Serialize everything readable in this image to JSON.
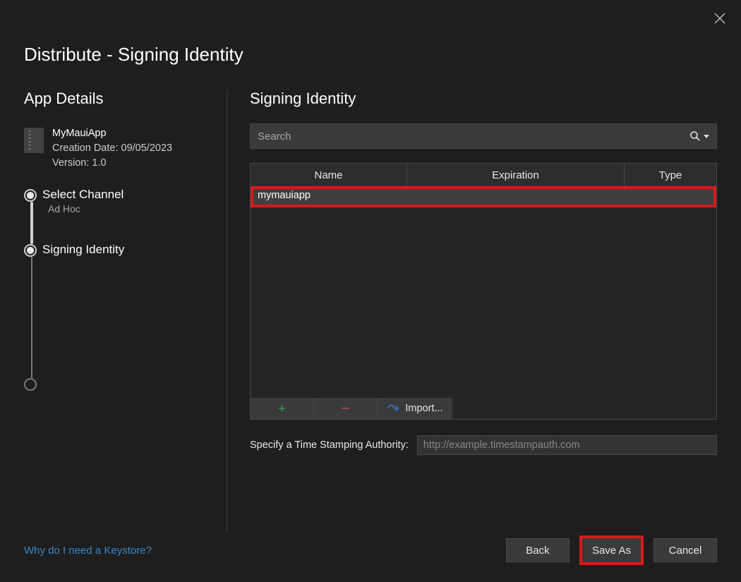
{
  "window": {
    "title": "Distribute - Signing Identity"
  },
  "left": {
    "heading": "App Details",
    "app": {
      "name": "MyMauiApp",
      "creation_line": "Creation Date: 09/05/2023",
      "version_line": "Version: 1.0"
    },
    "steps": [
      {
        "title": "Select Channel",
        "subtitle": "Ad Hoc"
      },
      {
        "title": "Signing Identity",
        "subtitle": ""
      },
      {
        "title": "",
        "subtitle": ""
      }
    ]
  },
  "right": {
    "heading": "Signing Identity",
    "search": {
      "placeholder": "Search",
      "value": ""
    },
    "table": {
      "columns": {
        "name": "Name",
        "expiration": "Expiration",
        "type": "Type"
      },
      "rows": [
        {
          "name": "mymauiapp",
          "expiration": "",
          "type": ""
        }
      ]
    },
    "toolbar": {
      "add": "+",
      "remove": "−",
      "import": "Import..."
    },
    "tsa": {
      "label": "Specify a Time Stamping Authority:",
      "placeholder": "http://example.timestampauth.com",
      "value": ""
    }
  },
  "footer": {
    "link": "Why do I need a Keystore?",
    "back": "Back",
    "save_as": "Save As",
    "cancel": "Cancel"
  }
}
